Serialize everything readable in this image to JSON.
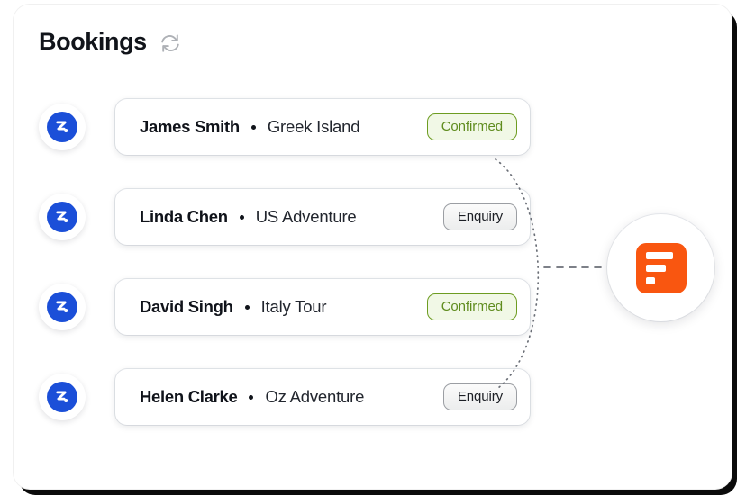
{
  "card": {
    "title": "Bookings",
    "refresh_icon": "refresh-sync-icon"
  },
  "bookings": [
    {
      "avatar_icon": "booking-app-logo-icon",
      "customer": "James Smith",
      "trip": "Greek Island",
      "status": "Confirmed",
      "status_type": "confirmed"
    },
    {
      "avatar_icon": "booking-app-logo-icon",
      "customer": "Linda Chen",
      "trip": "US Adventure",
      "status": "Enquiry",
      "status_type": "enquiry"
    },
    {
      "avatar_icon": "booking-app-logo-icon",
      "customer": "David Singh",
      "trip": "Italy Tour",
      "status": "Confirmed",
      "status_type": "confirmed"
    },
    {
      "avatar_icon": "booking-app-logo-icon",
      "customer": "Helen Clarke",
      "trip": "Oz Adventure",
      "status": "Enquiry",
      "status_type": "enquiry"
    }
  ],
  "destination": {
    "icon": "document-form-icon"
  },
  "colors": {
    "avatar_blue": "#1b4fd8",
    "destination_orange": "#f95610",
    "confirmed_border": "#6d9c21",
    "confirmed_bg": "#f1f8e6",
    "confirmed_text": "#5f8c1e",
    "enquiry_border": "#9b9ea3",
    "enquiry_text": "#1c1f25",
    "title_text": "#11141a",
    "connector_line": "#6b6f77"
  }
}
